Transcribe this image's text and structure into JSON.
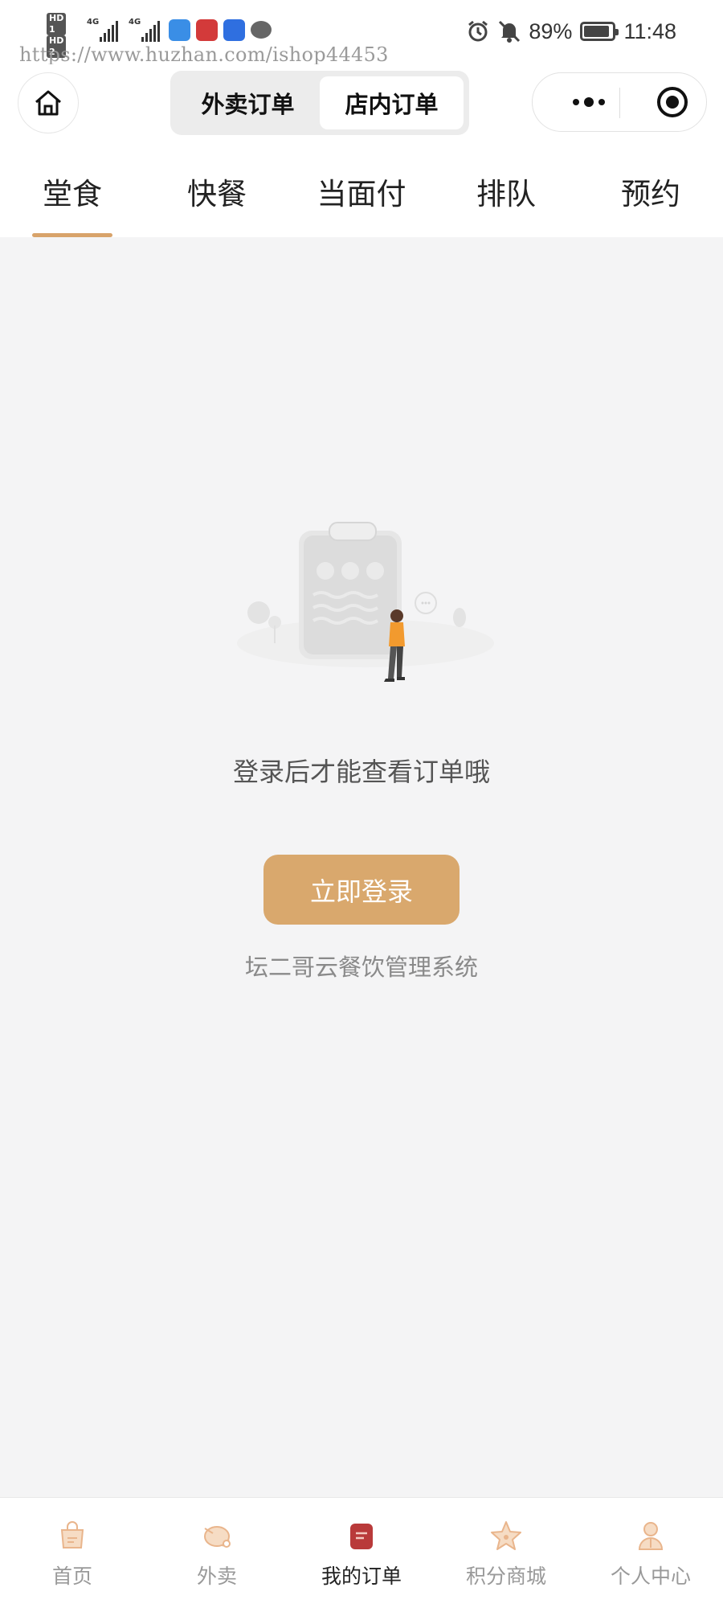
{
  "status_bar": {
    "hd_1": "HD 1",
    "hd_2": "HD 2",
    "net_1": "4G",
    "net_2": "4G",
    "battery_percent": "89%",
    "time": "11:48"
  },
  "watermark": "https://www.huzhan.com/ishop44453",
  "header": {
    "segments": [
      "外卖订单",
      "店内订单"
    ],
    "active_segment": 1
  },
  "tabs": {
    "items": [
      "堂食",
      "快餐",
      "当面付",
      "排队",
      "预约"
    ],
    "active": 0
  },
  "empty_state": {
    "message": "登录后才能查看订单哦",
    "login_button": "立即登录",
    "brand": "坛二哥云餐饮管理系统"
  },
  "tabbar": {
    "items": [
      {
        "label": "首页",
        "icon": "home-bag-icon"
      },
      {
        "label": "外卖",
        "icon": "delivery-icon"
      },
      {
        "label": "我的订单",
        "icon": "order-icon"
      },
      {
        "label": "积分商城",
        "icon": "star-icon"
      },
      {
        "label": "个人中心",
        "icon": "user-icon"
      }
    ],
    "active": 2
  },
  "colors": {
    "accent": "#d9a86d",
    "tab_underline": "#d8a36a",
    "background": "#f4f4f5",
    "active_tab_icon": "#b93a3a"
  }
}
